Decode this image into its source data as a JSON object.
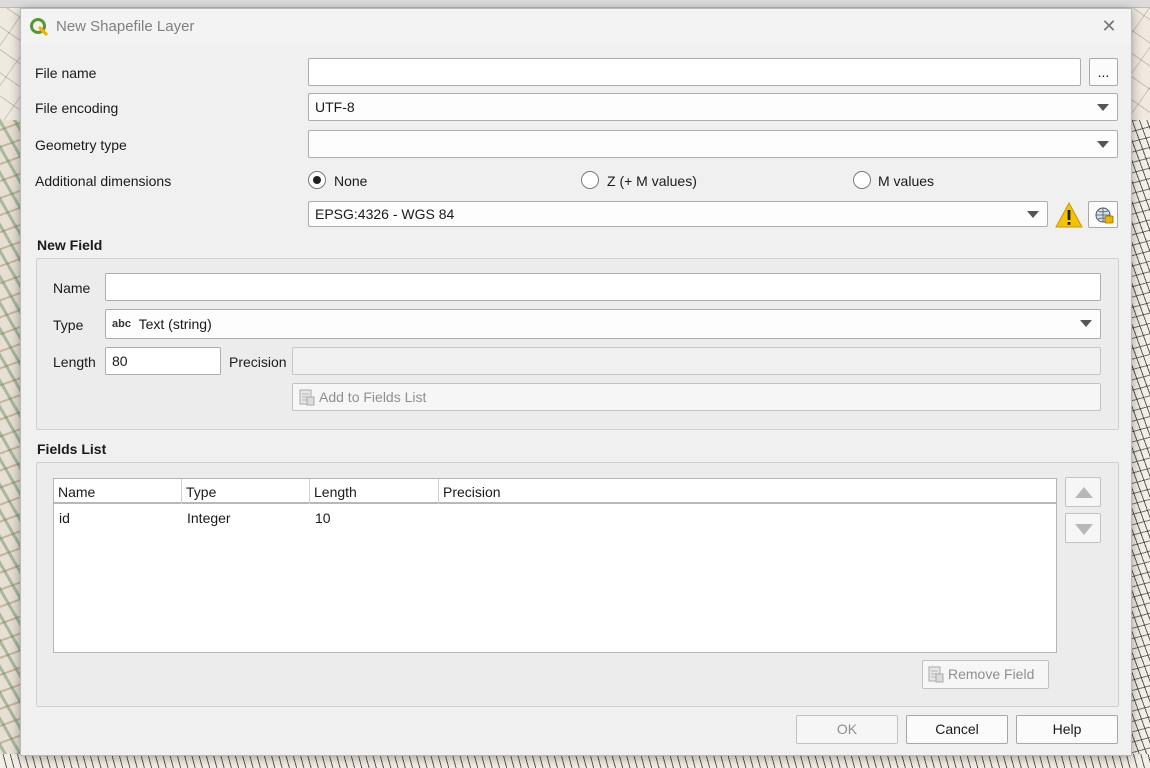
{
  "dialog": {
    "title": "New Shapefile Layer",
    "close_glyph": "✕"
  },
  "form": {
    "file_name_label": "File name",
    "file_name_value": "",
    "browse_label": "...",
    "file_encoding_label": "File encoding",
    "file_encoding_value": "UTF-8",
    "geometry_type_label": "Geometry type",
    "geometry_type_value": "",
    "additional_dimensions_label": "Additional dimensions",
    "dimensions_options": [
      "None",
      "Z (+ M values)",
      "M values"
    ],
    "dimensions_selected": "None",
    "crs_value": "EPSG:4326 - WGS 84"
  },
  "new_field": {
    "section_title": "New Field",
    "name_label": "Name",
    "name_value": "",
    "type_label": "Type",
    "type_prefix": "abc",
    "type_value": "Text (string)",
    "length_label": "Length",
    "length_value": "80",
    "precision_label": "Precision",
    "precision_value": "",
    "add_button": "Add to Fields List"
  },
  "fields_list": {
    "section_title": "Fields List",
    "columns": [
      "Name",
      "Type",
      "Length",
      "Precision"
    ],
    "rows": [
      {
        "name": "id",
        "type": "Integer",
        "length": "10",
        "precision": ""
      }
    ],
    "remove_button": "Remove Field"
  },
  "buttons": {
    "ok": "OK",
    "cancel": "Cancel",
    "help": "Help"
  },
  "icons": {
    "app": "qgis-logo-icon",
    "warning": "warning-icon",
    "crs": "globe-crs-icon",
    "accent_green": "#589632",
    "warning_yellow": "#f5c400"
  }
}
